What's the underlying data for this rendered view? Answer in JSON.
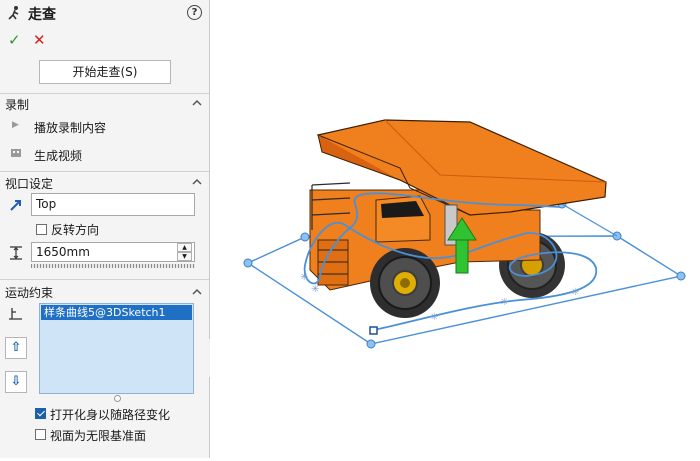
{
  "panel": {
    "title": "走查",
    "help_icon": "question-circle-icon",
    "ok_icon": "checkmark-icon",
    "cancel_icon": "close-icon",
    "start_button_label": "开始走查(S)",
    "record": {
      "header": "录制",
      "play_label": "播放录制内容",
      "video_label": "生成视频"
    },
    "viewport": {
      "header": "视口设定",
      "view_value": "Top",
      "reverse_label": "反转方向",
      "reverse_checked": false,
      "height_value": "1650mm"
    },
    "motion": {
      "header": "运动约束",
      "path_items": [
        "样条曲线5@3DSketch1"
      ],
      "follow_path_label": "打开化身以随路径变化",
      "follow_path_checked": true,
      "infinite_plane_label": "视面为无限基准面",
      "infinite_plane_checked": false
    }
  },
  "colors": {
    "truck_body": "#f07f1d",
    "path_line": "#4a90d9",
    "arrow": "#2fc332"
  }
}
